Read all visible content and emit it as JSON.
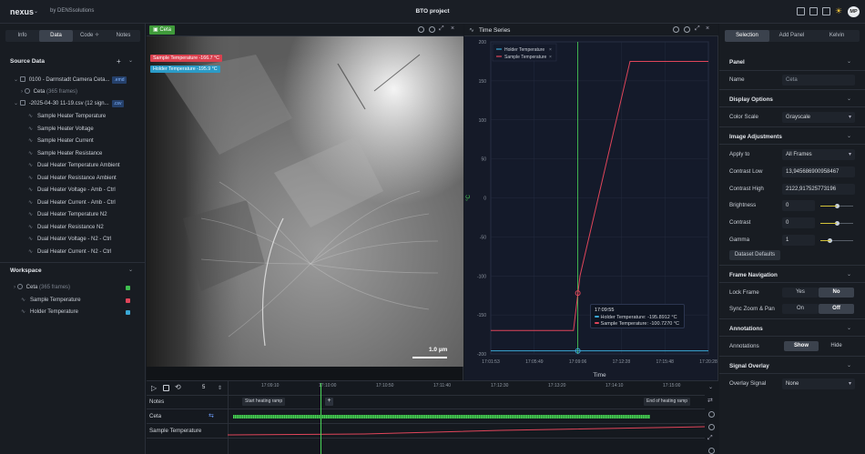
{
  "topbar": {
    "app_name": "nexus",
    "byline": "by DENSsolutions",
    "project": "BTO project",
    "avatar": "MP"
  },
  "left": {
    "tabs": [
      "Info",
      "Data",
      "Code",
      "Notes"
    ],
    "active_tab": "Data",
    "source_title": "Source Data",
    "source_items": [
      {
        "label": "0100 - Darmstadt Camera Ceta...",
        "badge": ".emd",
        "level": 0
      },
      {
        "label": "Ceta",
        "extra": "(365 frames)",
        "level": 1
      },
      {
        "label": "-2025-04-30 11-19.csv (12 sign...",
        "badge": ".csv",
        "level": 0
      }
    ],
    "signals": [
      "Sample Heater Temperature",
      "Sample Heater Voltage",
      "Sample Heater Current",
      "Sample Heater Resistance",
      "Dual Heater Temperature Ambient",
      "Dual Heater Resistance Ambient",
      "Dual Heater Voltage - Amb - Ctrl",
      "Dual Heater Current - Amb - Ctrl",
      "Dual Heater Temperature N2",
      "Dual Heater Resistance N2",
      "Dual Heater Voltage - N2 - Ctrl",
      "Dual Heater Current - N2 - Ctrl"
    ],
    "workspace_title": "Workspace",
    "workspace_items": [
      {
        "label": "Ceta",
        "extra": "(365 frames)",
        "color": "#3fbf4f"
      },
      {
        "label": "Sample Temperature",
        "extra": "",
        "color": "#e0455a"
      },
      {
        "label": "Holder Temperature",
        "extra": "",
        "color": "#3aa8d6"
      }
    ]
  },
  "image_panel": {
    "tag": "Ceta",
    "overlay_sample": "Sample Temperature -166.7 °C",
    "overlay_holder": "Holder Temperature -195.9 °C",
    "scale": "1.0 µm"
  },
  "chart_panel": {
    "title": "Time Series",
    "tooltip_time": "17:09:55",
    "tooltip_holder": "Holder Temperature: -195.8912 °C",
    "tooltip_sample": "Sample Temperature: -100.7270 °C"
  },
  "chart_data": {
    "type": "line",
    "xlabel": "Time",
    "ylabel": "°C",
    "ylim": [
      -200,
      200
    ],
    "yticks": [
      200,
      150,
      100,
      50,
      0,
      -50,
      -100,
      -150,
      -200
    ],
    "xticks": [
      "17:01:53",
      "17:05:49",
      "17:09:06",
      "17:12:28",
      "17:15:48",
      "17:20:28"
    ],
    "legend": "top-left",
    "grid": true,
    "cursor_x": "17:09:06",
    "series": [
      {
        "name": "Holder Temperature",
        "color": "#3aa8d6",
        "points": [
          [
            0.0,
            -196
          ],
          [
            0.25,
            -196
          ],
          [
            0.5,
            -196
          ],
          [
            0.75,
            -196
          ],
          [
            1.0,
            -196
          ]
        ]
      },
      {
        "name": "Sample Temperature",
        "color": "#e0455a",
        "points": [
          [
            0.0,
            -170
          ],
          [
            0.38,
            -170
          ],
          [
            0.41,
            -100
          ],
          [
            0.64,
            175
          ],
          [
            0.66,
            175
          ],
          [
            1.0,
            175
          ]
        ]
      }
    ]
  },
  "timeline": {
    "play_speed": "5",
    "ticks": [
      "17:09:10",
      "17:10:00",
      "17:10:50",
      "17:11:40",
      "17:12:30",
      "17:13:20",
      "17:14:10",
      "17:15:00"
    ],
    "rows": [
      "Notes",
      "Ceta",
      "Sample Temperature"
    ],
    "flag_start": "Start heating ramp",
    "flag_end": "End of heating ramp"
  },
  "right": {
    "tabs": [
      "Selection",
      "Add Panel",
      "Kelvin"
    ],
    "active_tab": "Selection",
    "panel_title": "Panel",
    "name_label": "Name",
    "name_value": "Ceta",
    "display_title": "Display Options",
    "colorscale_label": "Color Scale",
    "colorscale_value": "Grayscale",
    "adjust_title": "Image Adjustments",
    "apply_label": "Apply to",
    "apply_value": "All Frames",
    "contrast_low_label": "Contrast Low",
    "contrast_low_value": "13,945686900958467",
    "contrast_high_label": "Contrast High",
    "contrast_high_value": "2122,917525773196",
    "brightness_label": "Brightness",
    "brightness_value": "0",
    "brightness_slider": 0.5,
    "contrast_label": "Contrast",
    "contrast_value": "0",
    "contrast_slider": 0.5,
    "gamma_label": "Gamma",
    "gamma_value": "1",
    "gamma_slider": 0.3,
    "dataset_defaults": "Dataset Defaults",
    "frame_nav_title": "Frame Navigation",
    "lock_label": "Lock Frame",
    "yes": "Yes",
    "no": "No",
    "sync_label": "Sync Zoom & Pan",
    "on": "On",
    "off": "Off",
    "annotations_title": "Annotations",
    "annotations_label": "Annotations",
    "show": "Show",
    "hide": "Hide",
    "signal_overlay_title": "Signal Overlay",
    "overlay_signal_label": "Overlay Signal",
    "overlay_signal_value": "None"
  }
}
